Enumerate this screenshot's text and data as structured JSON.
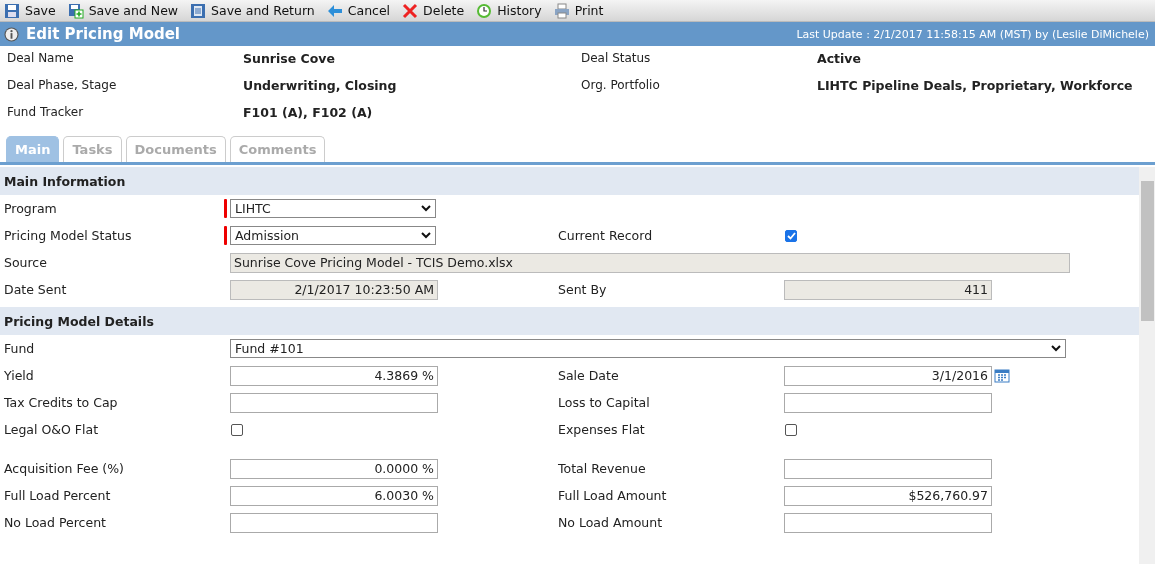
{
  "toolbar": [
    {
      "kind": "save",
      "label": "Save"
    },
    {
      "kind": "save-new",
      "label": "Save and New"
    },
    {
      "kind": "save-return",
      "label": "Save and Return"
    },
    {
      "kind": "cancel",
      "label": "Cancel"
    },
    {
      "kind": "delete",
      "label": "Delete"
    },
    {
      "kind": "history",
      "label": "History"
    },
    {
      "kind": "print",
      "label": "Print"
    }
  ],
  "title_bar": {
    "title": "Edit Pricing Model",
    "last_update": "Last Update : 2/1/2017 11:58:15 AM (MST) by (Leslie DiMichele)"
  },
  "summary": [
    {
      "label": "Deal Name",
      "value": "Sunrise Cove",
      "label2": "Deal Status",
      "value2": "Active"
    },
    {
      "label": "Deal Phase, Stage",
      "value": "Underwriting, Closing",
      "label2": "Org. Portfolio",
      "value2": "LIHTC Pipeline Deals, Proprietary, Workforce"
    },
    {
      "label": "Fund Tracker",
      "value": "F101 (A), F102 (A)"
    }
  ],
  "tabs": [
    {
      "label": "Main",
      "selected": true
    },
    {
      "label": "Tasks",
      "selected": false
    },
    {
      "label": "Documents",
      "selected": false
    },
    {
      "label": "Comments",
      "selected": false
    }
  ],
  "sections": [
    {
      "title": "Main Information",
      "rows": [
        {
          "cells": [
            {
              "label": "Program",
              "field": {
                "kind": "select",
                "value": "LIHTC",
                "required": true
              }
            }
          ]
        },
        {
          "cells": [
            {
              "label": "Pricing Model Status",
              "field": {
                "kind": "select",
                "value": "Admission",
                "required": true
              }
            },
            {
              "label": "Current Record",
              "field": {
                "kind": "checkbox",
                "checked": true
              }
            }
          ]
        },
        {
          "cells": [
            {
              "label": "Source",
              "field": {
                "kind": "readonly",
                "value": "Sunrise Cove Pricing Model - TCIS Demo.xlsx",
                "wide": true
              }
            }
          ]
        },
        {
          "cells": [
            {
              "label": "Date Sent",
              "field": {
                "kind": "readonly",
                "value": "2/1/2017 10:23:50 AM"
              }
            },
            {
              "label": "Sent By",
              "field": {
                "kind": "readonly",
                "value": "411"
              }
            }
          ]
        }
      ]
    },
    {
      "title": "Pricing Model Details",
      "rows": [
        {
          "cells": [
            {
              "label": "Fund",
              "field": {
                "kind": "select",
                "value": "Fund #101",
                "wide": true
              }
            }
          ]
        },
        {
          "cells": [
            {
              "label": "Yield",
              "field": {
                "kind": "input",
                "value": "4.3869 %"
              }
            },
            {
              "label": "Sale Date",
              "field": {
                "kind": "date",
                "value": "3/1/2016"
              }
            }
          ]
        },
        {
          "cells": [
            {
              "label": "Tax Credits to Cap",
              "field": {
                "kind": "input"
              }
            },
            {
              "label": "Loss to Capital",
              "field": {
                "kind": "input"
              }
            }
          ]
        },
        {
          "cells": [
            {
              "label": "Legal O&O Flat",
              "field": {
                "kind": "checkbox",
                "checked": false
              }
            },
            {
              "label": "Expenses Flat",
              "field": {
                "kind": "checkbox",
                "checked": false
              }
            }
          ]
        },
        {
          "spacer": true,
          "cells": []
        },
        {
          "cells": [
            {
              "label": "Acquisition Fee (%)",
              "field": {
                "kind": "input",
                "value": "0.0000 %"
              }
            },
            {
              "label": "Total Revenue",
              "field": {
                "kind": "input"
              }
            }
          ]
        },
        {
          "cells": [
            {
              "label": "Full Load Percent",
              "field": {
                "kind": "input",
                "value": "6.0030 %"
              }
            },
            {
              "label": "Full Load Amount",
              "field": {
                "kind": "input",
                "value": "$526,760.97"
              }
            }
          ]
        },
        {
          "cells": [
            {
              "label": "No Load Percent",
              "field": {
                "kind": "input"
              }
            },
            {
              "label": "No Load Amount",
              "field": {
                "kind": "input"
              }
            }
          ]
        }
      ]
    }
  ]
}
